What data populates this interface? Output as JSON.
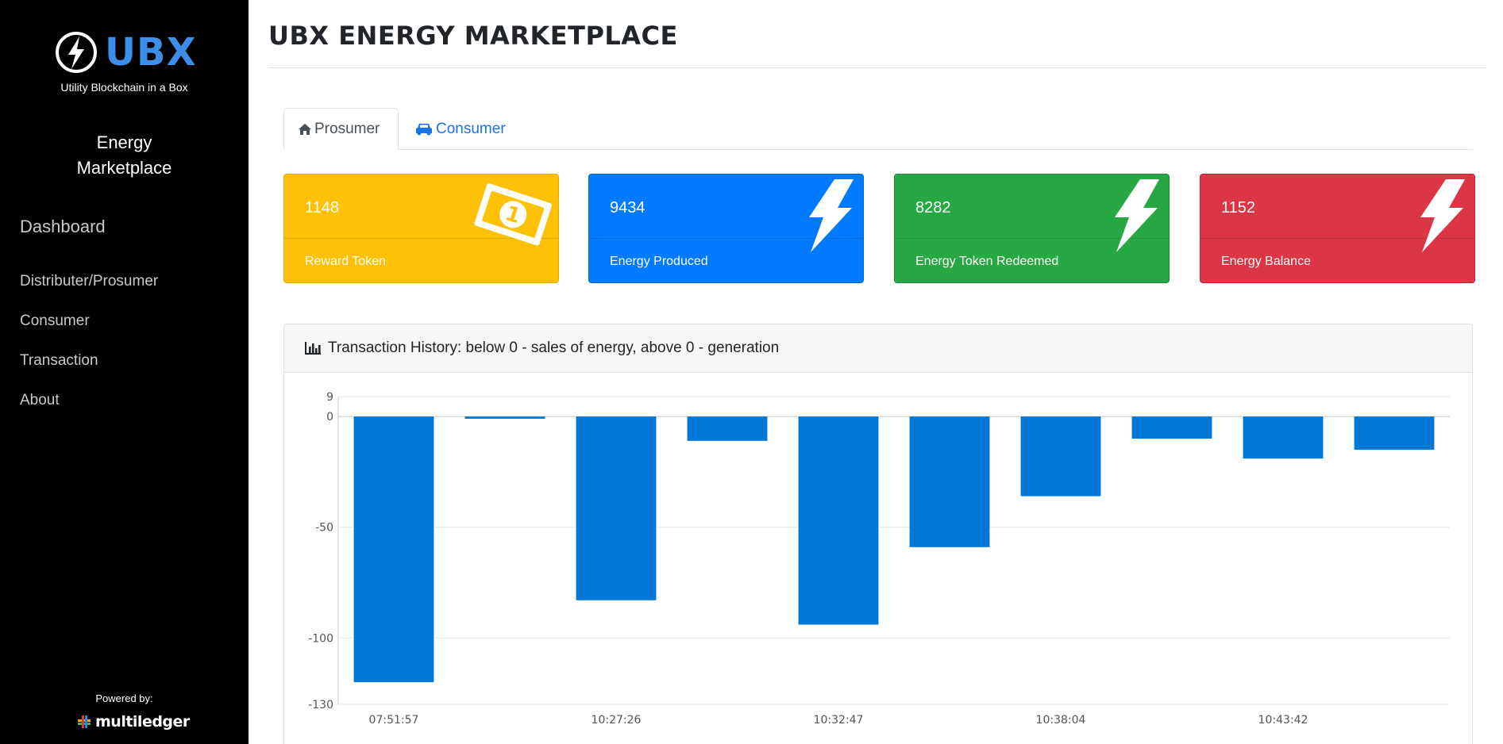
{
  "sidebar": {
    "logo_text": "UBX",
    "tagline": "Utility Blockchain in a Box",
    "brand_line1": "Energy",
    "brand_line2": "Marketplace",
    "nav": {
      "dashboard": "Dashboard",
      "distributer": "Distributer/Prosumer",
      "consumer": "Consumer",
      "transaction": "Transaction",
      "about": "About"
    },
    "powered_by": "Powered by:",
    "partner": "multiledger"
  },
  "header": {
    "title": "UBX ENERGY MARKETPLACE"
  },
  "tabs": {
    "prosumer": "Prosumer",
    "consumer": "Consumer"
  },
  "cards": [
    {
      "value": "1148",
      "label": "Reward Token",
      "color": "#ffc107",
      "icon": "money-bill-icon"
    },
    {
      "value": "9434",
      "label": "Energy Produced",
      "color": "#007bff",
      "icon": "bolt-icon"
    },
    {
      "value": "8282",
      "label": "Energy Token Redeemed",
      "color": "#28a745",
      "icon": "bolt-icon"
    },
    {
      "value": "1152",
      "label": "Energy Balance",
      "color": "#dc3545",
      "icon": "bolt-icon"
    }
  ],
  "panel": {
    "title": "Transaction History: below 0 - sales of energy, above 0 - generation"
  },
  "chart_data": {
    "type": "bar",
    "categories": [
      "07:51:57",
      "",
      "10:27:26",
      "",
      "10:32:47",
      "",
      "10:38:04",
      "",
      "10:43:42",
      ""
    ],
    "values": [
      -120,
      -1,
      -83,
      -11,
      -94,
      -59,
      -36,
      -10,
      -19,
      -15
    ],
    "yticks": [
      9,
      0,
      -50,
      -100,
      -130
    ],
    "ylim": [
      -130,
      9
    ],
    "bar_color": "#0078d7",
    "grid": true
  }
}
